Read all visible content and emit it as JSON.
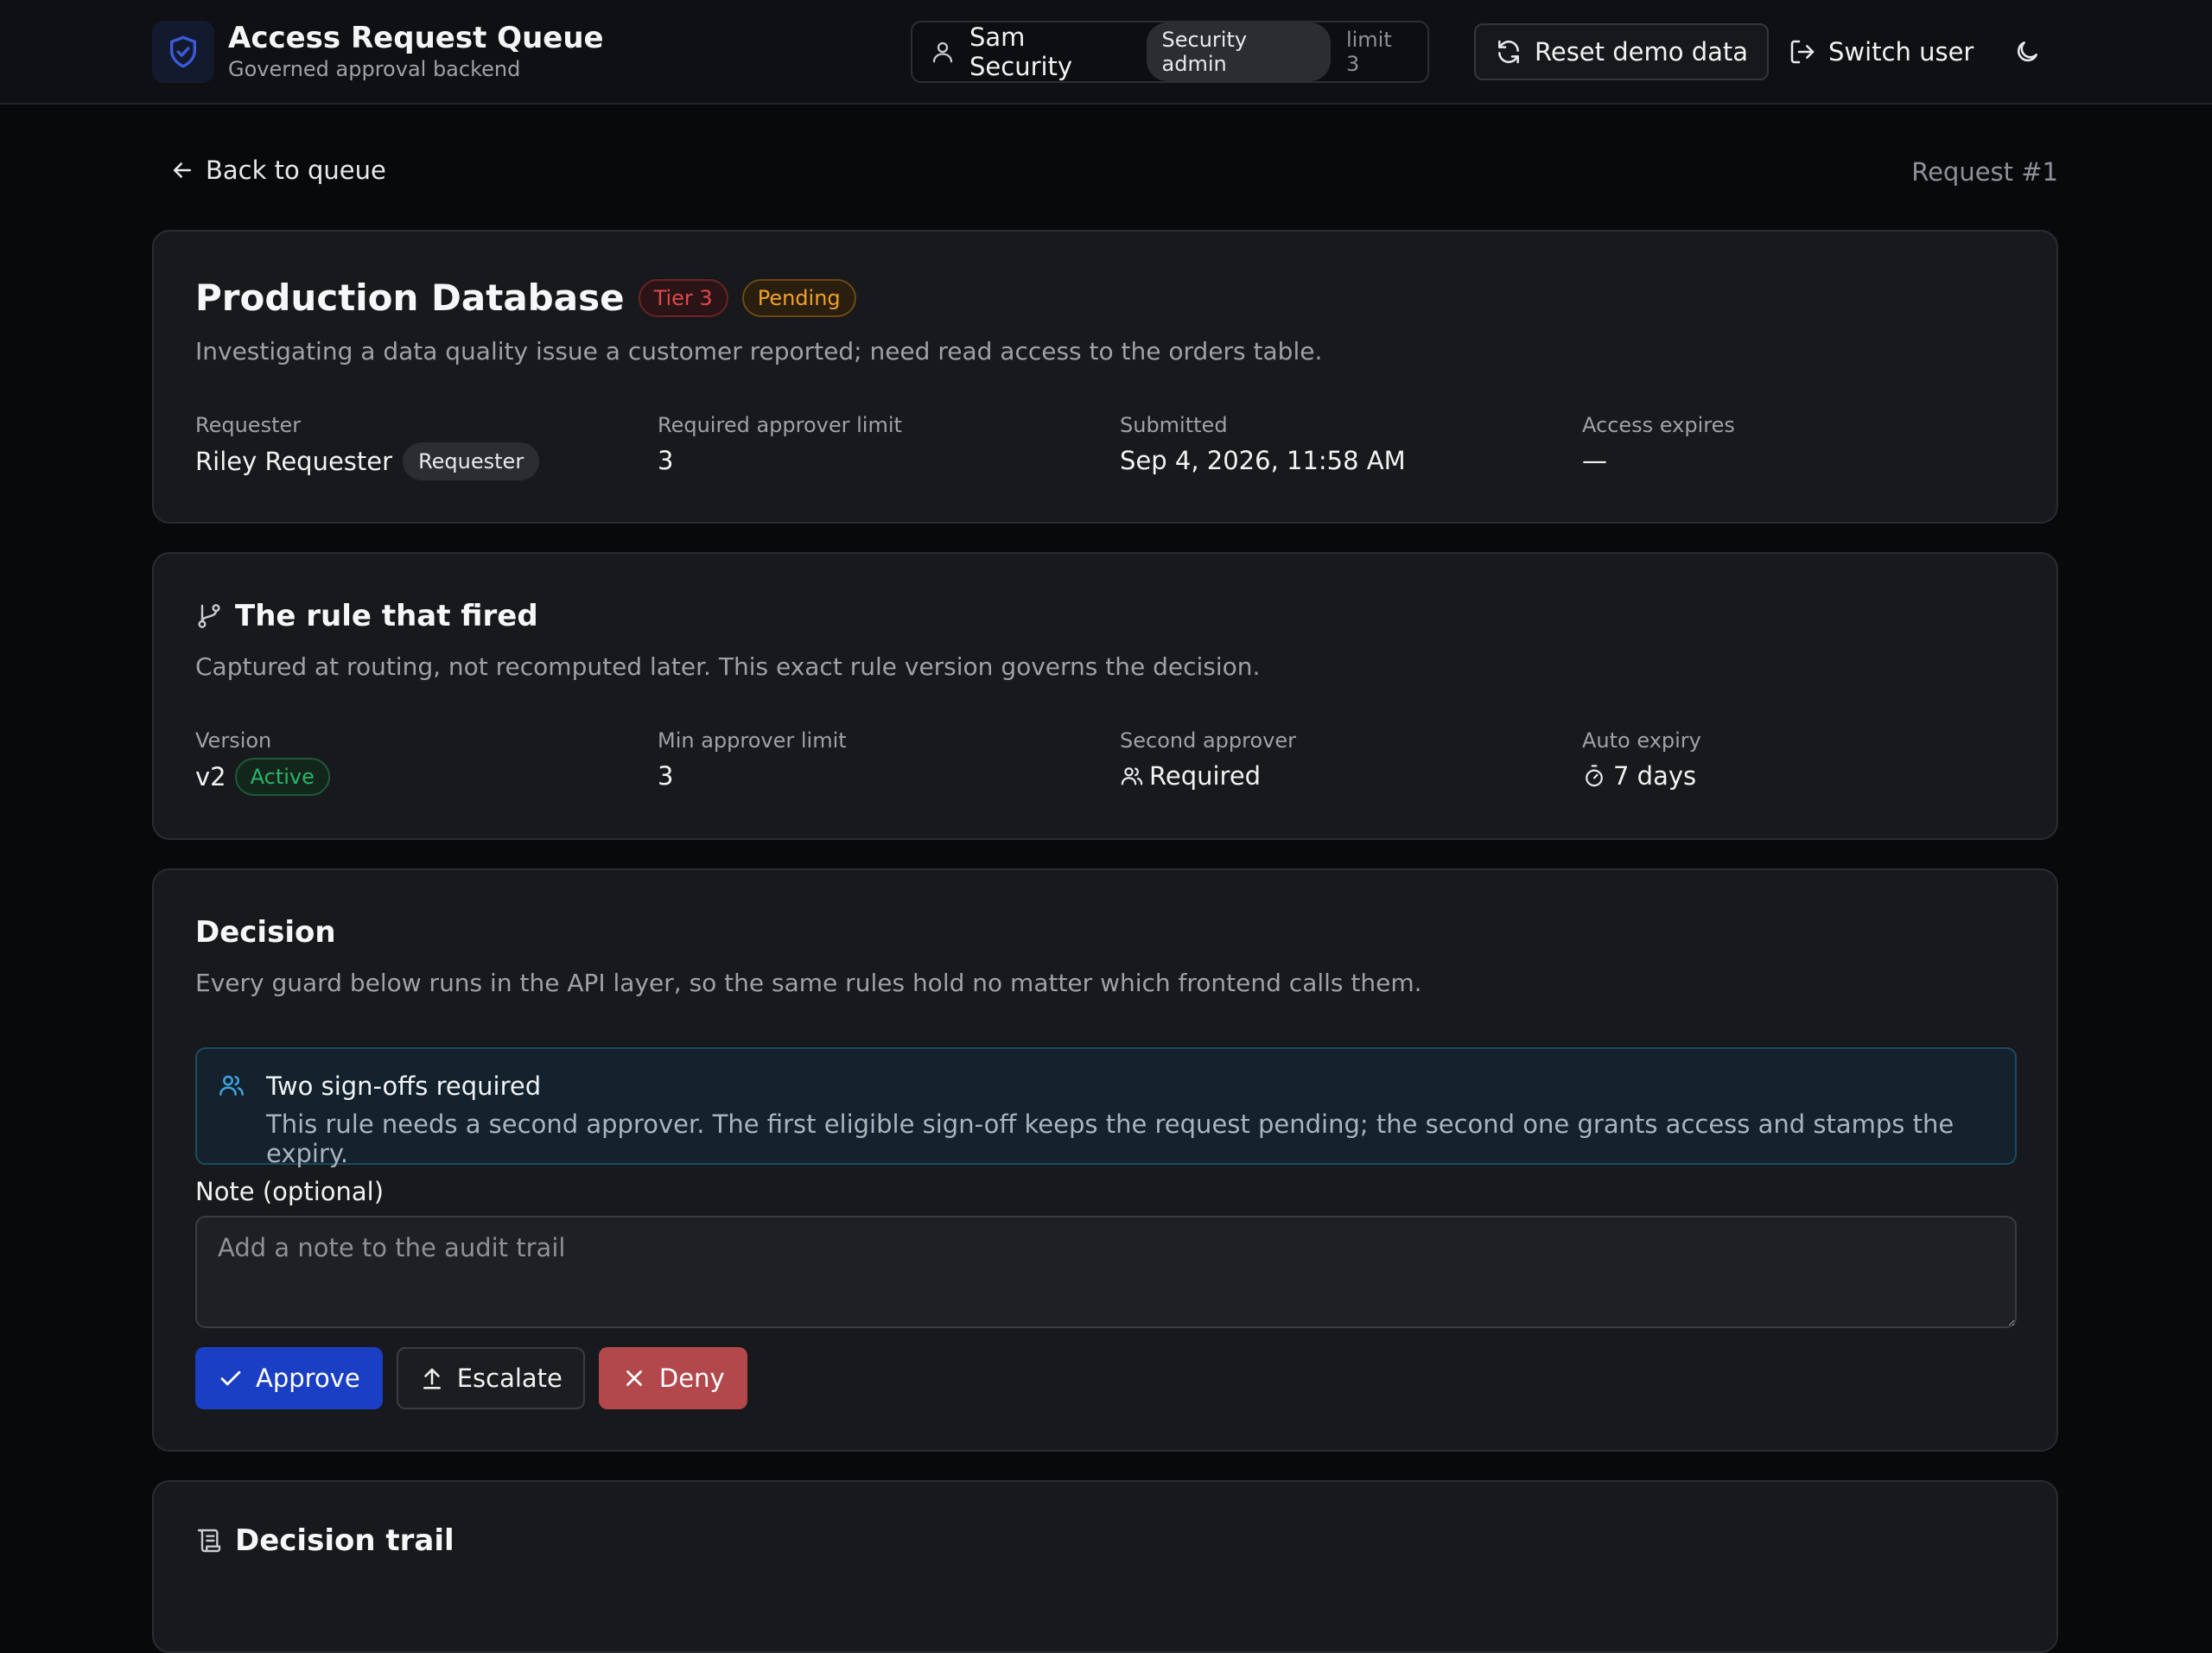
{
  "header": {
    "title": "Access Request Queue",
    "subtitle": "Governed approval backend",
    "user": {
      "name": "Sam Security",
      "role": "Security admin",
      "limit": "limit 3"
    },
    "reset_label": "Reset demo data",
    "switch_label": "Switch user"
  },
  "nav": {
    "back_label": "Back to queue",
    "request_id": "Request #1"
  },
  "request": {
    "resource": "Production Database",
    "tier": "Tier 3",
    "status": "Pending",
    "justification": "Investigating a data quality issue a customer reported; need read access to the orders table.",
    "fields": {
      "requester_label": "Requester",
      "requester_name": "Riley Requester",
      "requester_role": "Requester",
      "limit_label": "Required approver limit",
      "limit_value": "3",
      "submitted_label": "Submitted",
      "submitted_value": "Sep 4, 2026, 11:58 AM",
      "expires_label": "Access expires",
      "expires_value": "—"
    }
  },
  "rule": {
    "title": "The rule that fired",
    "description": "Captured at routing, not recomputed later. This exact rule version governs the decision.",
    "version_label": "Version",
    "version_value": "v2",
    "version_status": "Active",
    "min_limit_label": "Min approver limit",
    "min_limit_value": "3",
    "second_label": "Second approver",
    "second_value": "Required",
    "expiry_label": "Auto expiry",
    "expiry_value": "7 days"
  },
  "decision": {
    "title": "Decision",
    "description": "Every guard below runs in the API layer, so the same rules hold no matter which frontend calls them.",
    "info_title": "Two sign-offs required",
    "info_body": "This rule needs a second approver. The first eligible sign-off keeps the request pending; the second one grants access and stamps the expiry.",
    "note_label": "Note (optional)",
    "note_placeholder": "Add a note to the audit trail",
    "note_value": "",
    "approve_label": "Approve",
    "escalate_label": "Escalate",
    "deny_label": "Deny"
  },
  "trail": {
    "title": "Decision trail"
  },
  "colors": {
    "background": "#08090b",
    "card": "#18191c",
    "accent_blue": "#1b3fc4",
    "deny_red": "#b3484c",
    "tier_red": "#e0484d",
    "pending_amber": "#f0a12a",
    "active_green": "#2cb36a",
    "info_border": "#1d4a63"
  },
  "icons": {
    "logo": "shield-check-icon",
    "user": "user-icon",
    "reset": "refresh-icon",
    "switch": "log-out-icon",
    "theme": "moon-icon",
    "back": "arrow-left-icon",
    "rule": "git-branch-icon",
    "second_approver": "users-icon",
    "expiry": "timer-icon",
    "info": "users-icon",
    "approve": "check-icon",
    "escalate": "arrow-up-icon",
    "deny": "x-icon",
    "trail": "scroll-icon"
  }
}
